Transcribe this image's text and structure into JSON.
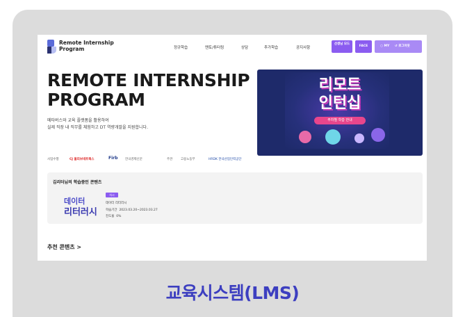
{
  "header": {
    "brand_line1": "Remote Internship",
    "brand_line2": "Program",
    "nav": [
      "정규학습",
      "멘토/튜터링",
      "상담",
      "추가학습",
      "공지사항"
    ],
    "btn_service": "선생님 모드",
    "btn_face": "FACE",
    "btn_mypage": "MY",
    "btn_logout": "로그아웃"
  },
  "hero": {
    "title_line1": "REMOTE INTERNSHIP",
    "title_line2": "PROGRAM",
    "sub_line1": "메타버스와 교육 플랫폼을 활용하여",
    "sub_line2": "실제 직장 내 직무를 체험하고 DT 역량개발을 지원합니다."
  },
  "banner": {
    "title_line1": "리모트",
    "title_line2": "인턴십",
    "pill": "주차별 학습 안내"
  },
  "partners": {
    "label1": "사업수행",
    "p1": "CJ 올리브네트웍스",
    "p2": "Firb",
    "p3": "한국경제신문",
    "label2": "주관",
    "p4": "고용노동부",
    "p5": "HRDK 한국산업인력공단"
  },
  "learning": {
    "title": "김리터님의 학습중인 콘텐츠",
    "thumb_line1": "데이터",
    "thumb_line2": "리터러시",
    "tag": "차시",
    "course": "데이터 리터러시",
    "period_label": "학습기간",
    "period": "2023.03.20~2023.03.27",
    "progress_label": "진도율",
    "progress": "0%"
  },
  "recommend": "추천 콘텐츠 >",
  "caption": "교육시스템(LMS)",
  "colors": {
    "accent": "#3d3fc0",
    "purple": "#8b5cf0",
    "banner": "#1e2a6a"
  }
}
